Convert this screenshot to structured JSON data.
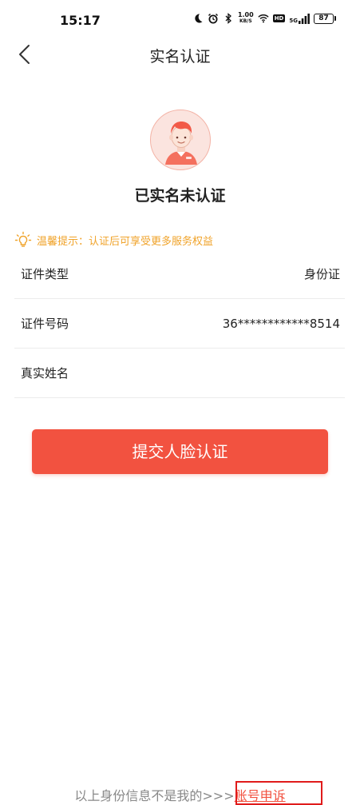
{
  "status_bar": {
    "time": "15:17",
    "network_speed": "1.00",
    "network_unit": "KB/S",
    "hd": "HD",
    "signal_type": "5G",
    "battery": "87"
  },
  "header": {
    "title": "实名认证"
  },
  "verification": {
    "status_text": "已实名未认证",
    "tip": "温馨提示：认证后可享受更多服务权益"
  },
  "fields": [
    {
      "label": "证件类型",
      "value": "身份证"
    },
    {
      "label": "证件号码",
      "value": "36************8514"
    },
    {
      "label": "真实姓名",
      "value": ""
    }
  ],
  "submit_label": "提交人脸认证",
  "footer": {
    "prefix": "以上身份信息不是我的>>>",
    "appeal_link": "账号申诉"
  },
  "colors": {
    "accent": "#f25240",
    "tip": "#f0a32a",
    "highlight_box": "#e01b1b"
  }
}
